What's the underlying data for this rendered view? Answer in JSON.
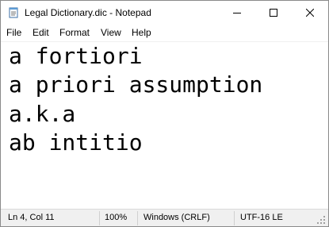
{
  "window": {
    "title": "Legal Dictionary.dic - Notepad",
    "app_icon": "notepad-icon"
  },
  "caption_buttons": {
    "minimize_icon": "minimize-icon",
    "maximize_icon": "maximize-icon",
    "close_icon": "close-icon"
  },
  "menu": {
    "items": [
      {
        "label": "File"
      },
      {
        "label": "Edit"
      },
      {
        "label": "Format"
      },
      {
        "label": "View"
      },
      {
        "label": "Help"
      }
    ]
  },
  "editor": {
    "lines": [
      "a fortiori",
      "a priori assumption",
      "a.k.a",
      "ab intitio"
    ]
  },
  "status": {
    "position": "Ln 4, Col 11",
    "zoom": "100%",
    "line_ending": "Windows (CRLF)",
    "encoding": "UTF-16 LE"
  }
}
